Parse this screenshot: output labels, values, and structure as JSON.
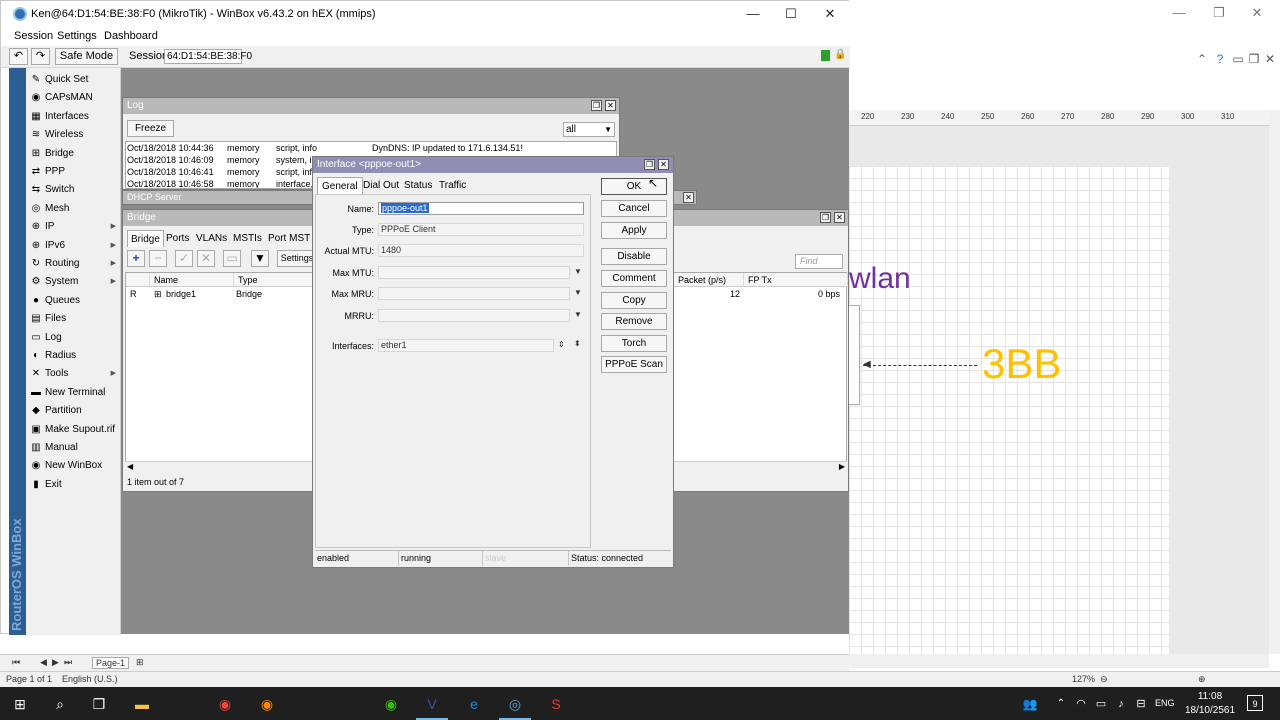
{
  "winbox": {
    "title": "Ken@64:D1:54:BE:38:F0 (MikroTik) - WinBox v6.43.2 on hEX (mmips)",
    "menu": [
      "Session",
      "Settings",
      "Dashboard"
    ],
    "toolbar": {
      "safe_mode": "Safe Mode",
      "session_label": "Session:",
      "session_value": "64:D1:54:BE:38:F0"
    },
    "vertical_brand": "RouterOS WinBox",
    "sidebar": [
      {
        "label": "Quick Set",
        "icon": "quick-set-icon",
        "glyph": "✎",
        "arrow": false
      },
      {
        "label": "CAPsMAN",
        "icon": "capsman-icon",
        "glyph": "◉",
        "arrow": false
      },
      {
        "label": "Interfaces",
        "icon": "interfaces-icon",
        "glyph": "▦",
        "arrow": false
      },
      {
        "label": "Wireless",
        "icon": "wireless-icon",
        "glyph": "≋",
        "arrow": false
      },
      {
        "label": "Bridge",
        "icon": "bridge-icon",
        "glyph": "⊞",
        "arrow": false
      },
      {
        "label": "PPP",
        "icon": "ppp-icon",
        "glyph": "⇄",
        "arrow": false
      },
      {
        "label": "Switch",
        "icon": "switch-icon",
        "glyph": "⇆",
        "arrow": false
      },
      {
        "label": "Mesh",
        "icon": "mesh-icon",
        "glyph": "◎",
        "arrow": false
      },
      {
        "label": "IP",
        "icon": "ip-icon",
        "glyph": "⊕",
        "arrow": true
      },
      {
        "label": "IPv6",
        "icon": "ipv6-icon",
        "glyph": "⊕",
        "arrow": true
      },
      {
        "label": "Routing",
        "icon": "routing-icon",
        "glyph": "↻",
        "arrow": true
      },
      {
        "label": "System",
        "icon": "system-icon",
        "glyph": "⚙",
        "arrow": true
      },
      {
        "label": "Queues",
        "icon": "queues-icon",
        "glyph": "●",
        "arrow": false
      },
      {
        "label": "Files",
        "icon": "files-icon",
        "glyph": "▤",
        "arrow": false
      },
      {
        "label": "Log",
        "icon": "log-icon",
        "glyph": "▭",
        "arrow": false
      },
      {
        "label": "Radius",
        "icon": "radius-icon",
        "glyph": "◐",
        "arrow": false
      },
      {
        "label": "Tools",
        "icon": "tools-icon",
        "glyph": "✕",
        "arrow": true
      },
      {
        "label": "New Terminal",
        "icon": "terminal-icon",
        "glyph": "▬",
        "arrow": false
      },
      {
        "label": "Partition",
        "icon": "partition-icon",
        "glyph": "◆",
        "arrow": false
      },
      {
        "label": "Make Supout.rif",
        "icon": "supout-icon",
        "glyph": "▣",
        "arrow": false
      },
      {
        "label": "Manual",
        "icon": "manual-icon",
        "glyph": "▥",
        "arrow": false
      },
      {
        "label": "New WinBox",
        "icon": "new-winbox-icon",
        "glyph": "◉",
        "arrow": false
      },
      {
        "label": "Exit",
        "icon": "exit-icon",
        "glyph": "▮",
        "arrow": false
      }
    ]
  },
  "log": {
    "title": "Log",
    "freeze": "Freeze",
    "filter": "all",
    "rows": [
      {
        "time": "Oct/18/2018 10:44:36",
        "buffer": "memory",
        "topics": "script, info",
        "message": "DynDNS: IP updated to 171.6.134.51!"
      },
      {
        "time": "Oct/18/2018 10:46:09",
        "buffer": "memory",
        "topics": "system, in",
        "message": ""
      },
      {
        "time": "Oct/18/2018 10:46:41",
        "buffer": "memory",
        "topics": "script, info",
        "message": ""
      },
      {
        "time": "Oct/18/2018 10:46:58",
        "buffer": "memory",
        "topics": "interface,",
        "message": ""
      }
    ]
  },
  "dhcp": {
    "title": "DHCP Server"
  },
  "bridge": {
    "title": "Bridge",
    "tabs": [
      "Bridge",
      "Ports",
      "VLANs",
      "MSTIs",
      "Port MST O"
    ],
    "settings": "Settings",
    "find": "Find",
    "columns": [
      "Name",
      "Type",
      "Packet (p/s)",
      "FP Tx"
    ],
    "row": {
      "flag": "R",
      "name": "bridge1",
      "type": "Bridge",
      "packet": "12",
      "fptx": "0 bps"
    },
    "status": "1 item out of 7"
  },
  "iface": {
    "title": "Interface <pppoe-out1>",
    "tabs": [
      "General",
      "Dial Out",
      "Status",
      "Traffic"
    ],
    "fields": {
      "name_label": "Name:",
      "name_value": "pppoe-out1",
      "type_label": "Type:",
      "type_value": "PPPoE Client",
      "mtu_label": "Actual MTU:",
      "mtu_value": "1480",
      "maxmtu_label": "Max MTU:",
      "maxmru_label": "Max MRU:",
      "mrru_label": "MRRU:",
      "interfaces_label": "Interfaces:",
      "interfaces_value": "ether1"
    },
    "buttons": [
      "OK",
      "Cancel",
      "Apply",
      "Disable",
      "Comment",
      "Copy",
      "Remove",
      "Torch",
      "PPPoE Scan"
    ],
    "status": [
      "enabled",
      "running",
      "slave",
      "Status: connected"
    ]
  },
  "visio": {
    "ruler": [
      "220",
      "230",
      "240",
      "250",
      "260",
      "270",
      "280",
      "290",
      "300",
      "310"
    ],
    "wlan": "wlan",
    "bb": "3BB",
    "page_tab": "Page-1",
    "page_status": "Page 1 of 1",
    "language": "English (U.S.)",
    "zoom": "127%"
  },
  "taskbar": {
    "lang": "ENG",
    "time": "11:08",
    "date": "18/10/2561",
    "notifications": "9"
  },
  "colors": {
    "wlan": "#7030a0",
    "bb": "#ffc000",
    "iface_title": "#8f8fb6",
    "vbar": "#2c5d93"
  }
}
